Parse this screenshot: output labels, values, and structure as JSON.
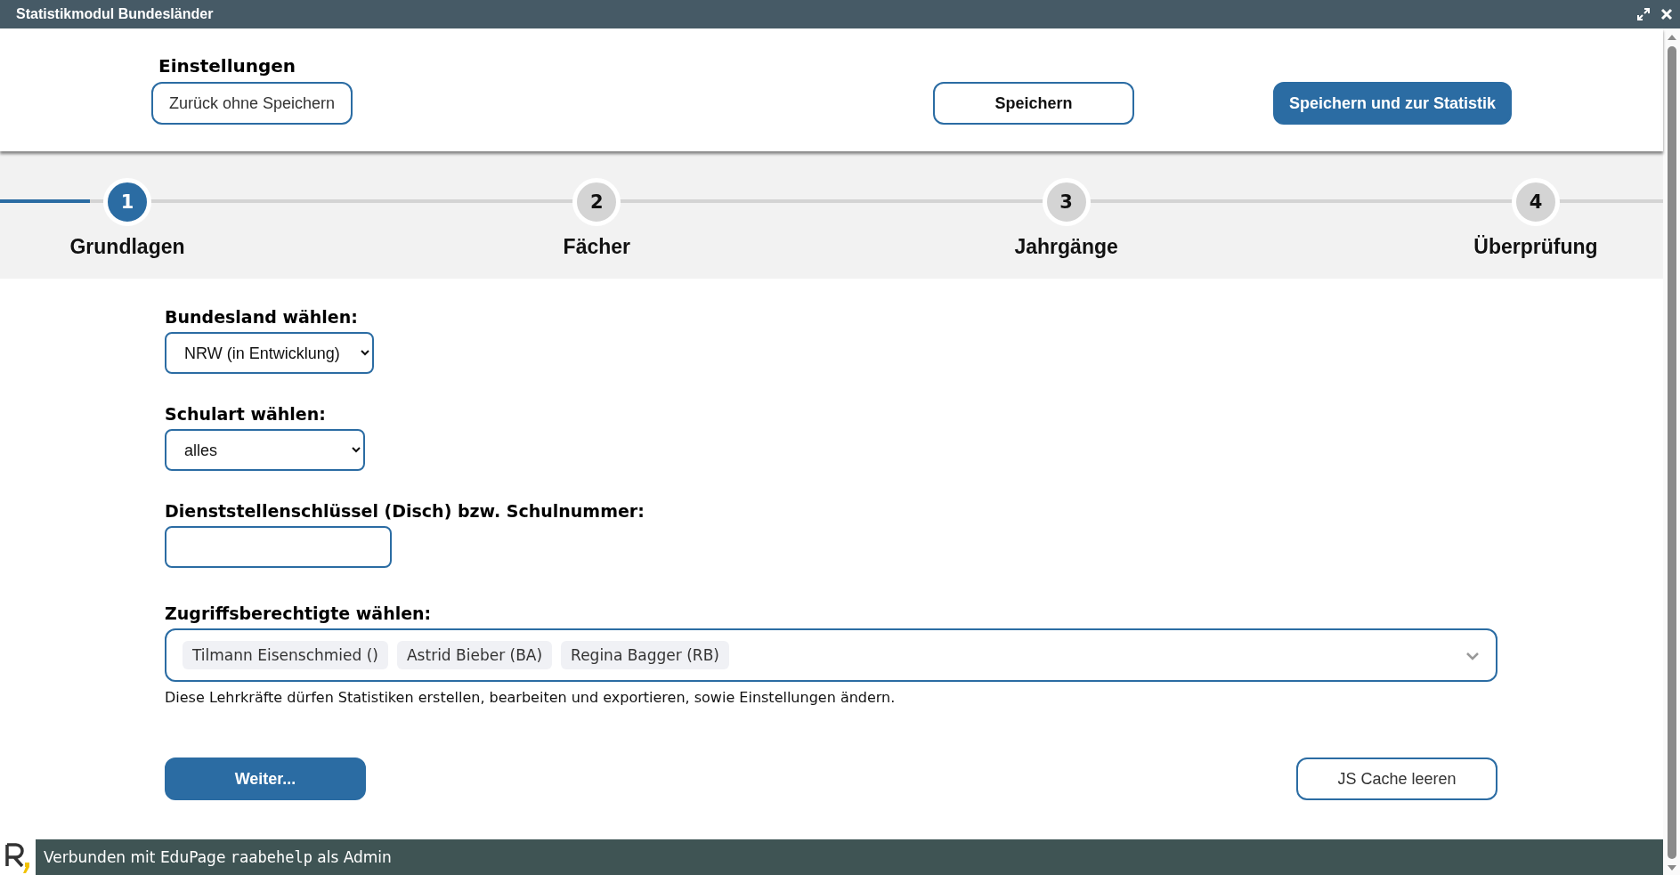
{
  "window": {
    "title": "Statistikmodul Bundesländer"
  },
  "header": {
    "title": "Einstellungen",
    "buttons": [
      {
        "label": "Zurück ohne Speichern",
        "kind": "outline"
      },
      {
        "label": "Speichern",
        "kind": "outline-bold"
      },
      {
        "label": "Speichern und zur Statistik",
        "kind": "primary"
      }
    ]
  },
  "steps": [
    {
      "number": "1",
      "label": "Grundlagen",
      "selected": true
    },
    {
      "number": "2",
      "label": "Fächer",
      "selected": false
    },
    {
      "number": "3",
      "label": "Jahrgänge",
      "selected": false
    },
    {
      "number": "4",
      "label": "Überprüfung",
      "selected": false
    }
  ],
  "form": {
    "bundesland": {
      "label": "Bundesland wählen:",
      "value": "NRW (in Entwicklung)"
    },
    "schulart": {
      "label": "Schulart wählen:",
      "value": "alles"
    },
    "schulnummer": {
      "label": "Dienststellenschlüssel (Disch) bzw. Schulnummer:"
    },
    "zugriff": {
      "label": "Zugriffsberechtigte wählen:",
      "tags": [
        "Tilmann Eisenschmied ()",
        "Astrid Bieber (BA)",
        "Regina Bagger (RB)"
      ],
      "help": "Diese Lehrkräfte dürfen Statistiken erstellen, bearbeiten und exportieren, sowie Einstellungen ändern."
    }
  },
  "actions": [
    {
      "label": "Weiter...",
      "kind": "primary"
    },
    {
      "label": "JS Cache leeren",
      "kind": "outline"
    }
  ],
  "status_bar": {
    "before": "Verbunden mit EduPage",
    "user": "raabehelp",
    "after": "als Admin"
  }
}
